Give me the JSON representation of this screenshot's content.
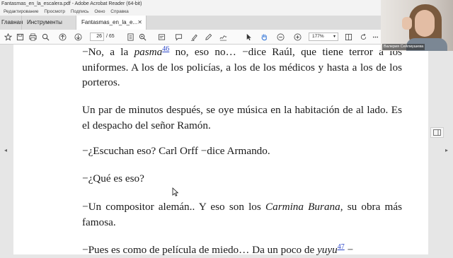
{
  "window": {
    "title": "Fantasmas_en_la_escalera.pdf - Adobe Acrobat Reader (64-bit)"
  },
  "menu": [
    "Редактирование",
    "Просмотр",
    "Подпись",
    "Окно",
    "Справка"
  ],
  "tabs": {
    "home": "Главная",
    "tools": "Инструменты",
    "document": "Fantasmas_en_la_e..."
  },
  "toolbar": {
    "current_page": "26",
    "total_pages": "/ 65",
    "zoom": "177%"
  },
  "document": {
    "p1": {
      "a": "−No, a la ",
      "b": "pasma",
      "note": "46",
      "c": " no, eso no… −dice Raúl, que tiene terror a los uniformes. A los de los policías, a los de los médicos y hasta a los de los porteros."
    },
    "p2": "Un par de minutos después, se oye música en la habitación de al lado. Es el despacho del señor Ramón.",
    "p3": "−¿Escuchan eso? Carl Orff −dice Armando.",
    "p4": "−¿Qué es eso?",
    "p5": {
      "a": "−Un compositor alemán.. Y eso son los ",
      "b": "Carmina Burana",
      "c": ", su obra más famosa."
    },
    "p6": {
      "a": "−Pues es como de película de miedo… Da un poco de ",
      "b": "yuyu",
      "note": "47",
      "c": " −"
    }
  },
  "webcam": {
    "name_label": "Валерия Сейлиушева"
  },
  "colors": {
    "footnote_link": "#2a45c8",
    "tabbar": "#dcdcdc",
    "page_background": "#ffffff",
    "viewer_background": "#e6e6e6"
  }
}
